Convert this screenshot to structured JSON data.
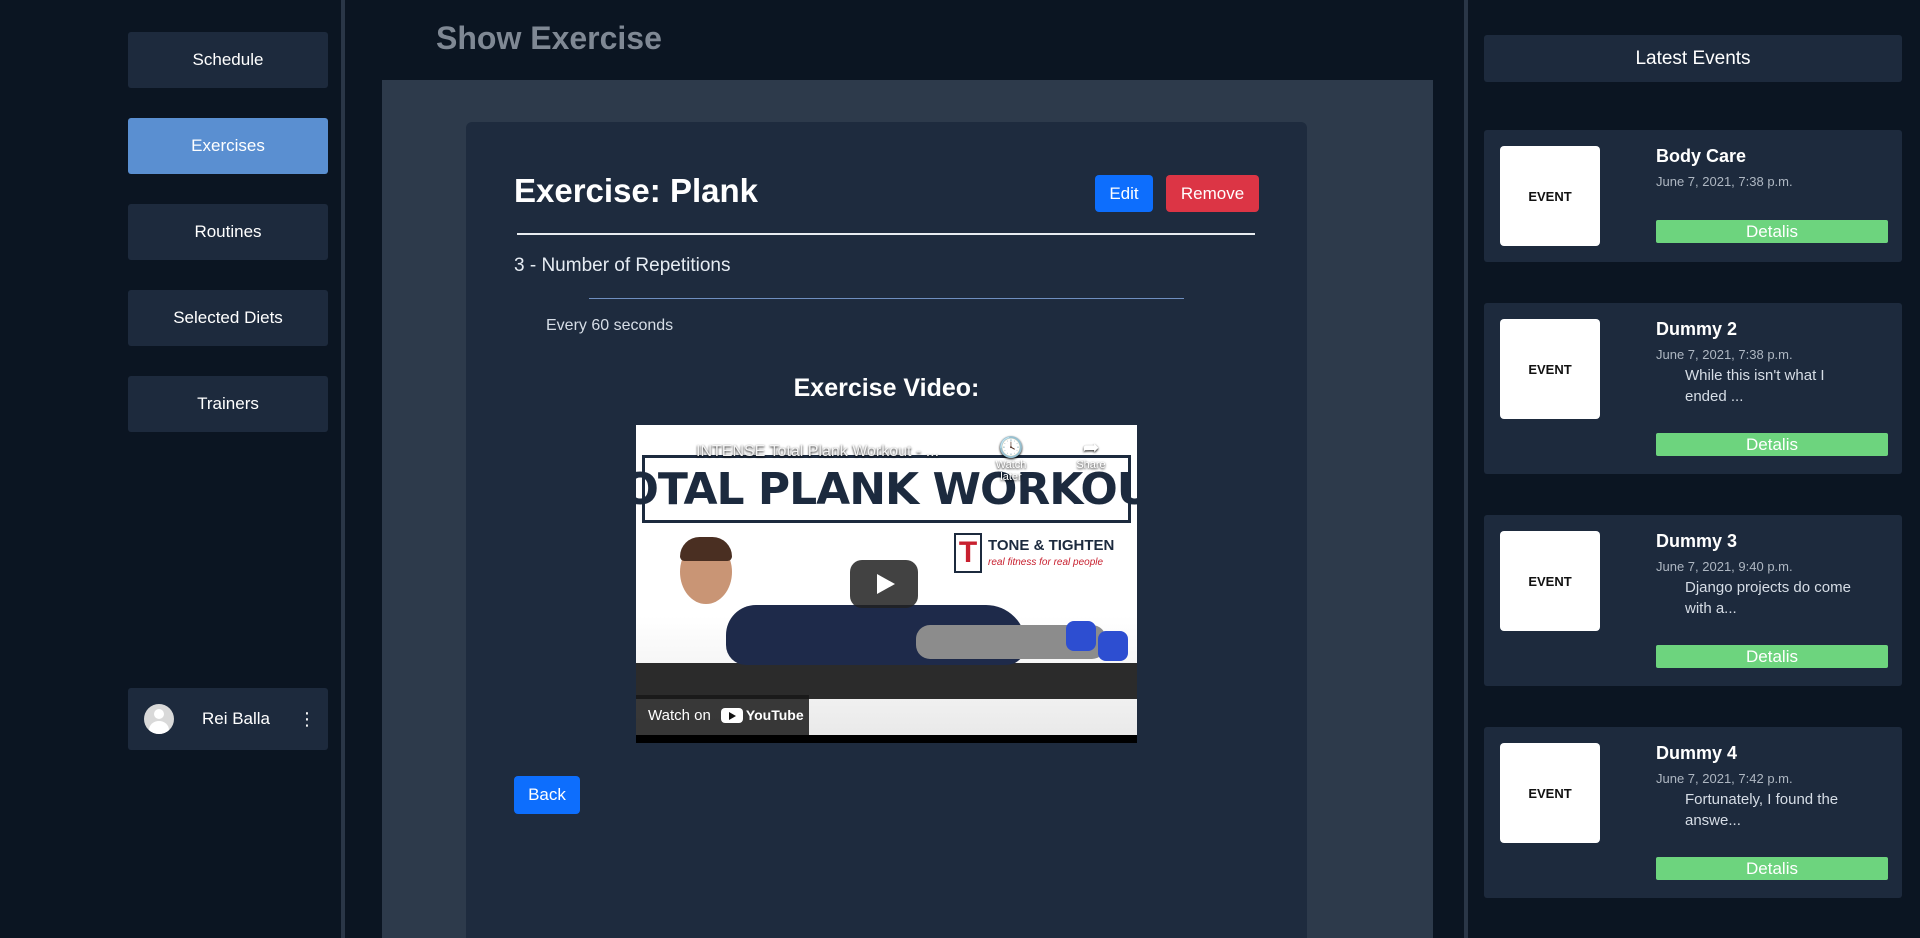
{
  "nav": {
    "items": [
      {
        "label": "Schedule"
      },
      {
        "label": "Exercises",
        "active": true
      },
      {
        "label": "Routines"
      },
      {
        "label": "Selected Diets"
      },
      {
        "label": "Trainers"
      }
    ],
    "user": {
      "name": "Rei Balla",
      "menu_icon": "⋮"
    }
  },
  "main": {
    "page_title": "Show Exercise",
    "exercise_title": "Exercise: Plank",
    "edit_label": "Edit",
    "remove_label": "Remove",
    "repetitions": "3 - Number of Repetitions",
    "interval": "Every 60 seconds",
    "video_heading": "Exercise Video:",
    "back_label": "Back"
  },
  "video": {
    "title": "INTENSE Total Plank Workout - ...",
    "banner": "TOTAL PLANK WORKOUT",
    "brand_name": "TONE & TIGHTEN",
    "brand_tagline": "real fitness for real people",
    "brand_letter": "T",
    "watch_later": "Watch later",
    "share": "Share",
    "watch_on": "Watch on",
    "youtube": "YouTube"
  },
  "events": {
    "header": "Latest Events",
    "thumb_label": "EVENT",
    "details_label": "Detalis",
    "items": [
      {
        "title": "Body Care",
        "date": "June 7, 2021, 7:38 p.m.",
        "excerpt": ""
      },
      {
        "title": "Dummy 2",
        "date": "June 7, 2021, 7:38 p.m.",
        "excerpt": "While this isn't what I ended ..."
      },
      {
        "title": "Dummy 3",
        "date": "June 7, 2021, 9:40 p.m.",
        "excerpt": "Django projects do come with a..."
      },
      {
        "title": "Dummy 4",
        "date": "June 7, 2021, 7:42 p.m.",
        "excerpt": "Fortunately, I found the answe..."
      }
    ]
  },
  "colors": {
    "background": "#0b1522",
    "card": "#1e2b3e",
    "active_nav": "#5a8fd1",
    "primary": "#0d6efd",
    "danger": "#dc3545",
    "success": "#6dd47e"
  }
}
